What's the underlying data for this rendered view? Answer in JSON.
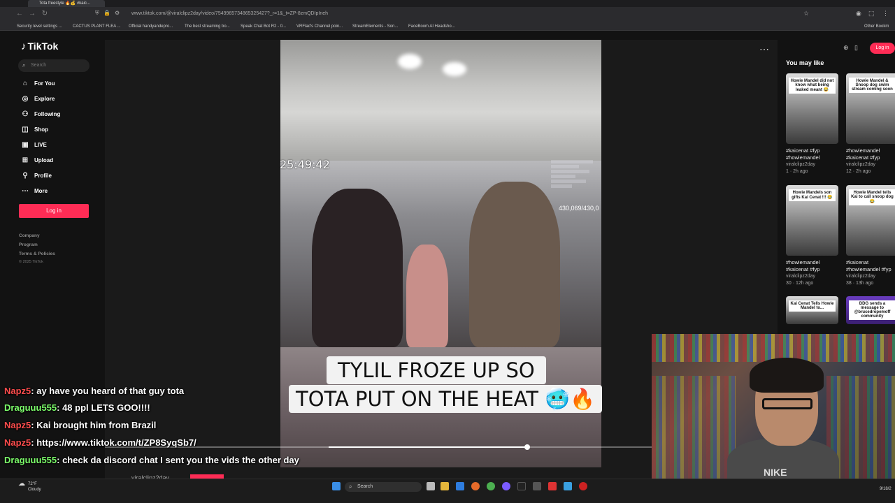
{
  "browser": {
    "tab_title": "Tota freestyle 🔥💰 #kaic...",
    "url": "www.tiktok.com/@viralclipz2day/video/7549965734865325427?_r=1&_t=ZP-8zmQDIpIneh",
    "bookmarks": [
      "Security level settings ...",
      "CACTUS PLANT FLEA ...",
      "Official handyandepro...",
      "The best streaming bo...",
      "Speak Chat Bot R2 - 0...",
      "VRFlad's Channel poin...",
      "StreamElements - Son...",
      "FaceBoom AI Headsho..."
    ],
    "other_bookmarks": "Other Bookm"
  },
  "tiktok": {
    "logo": "TikTok",
    "search_placeholder": "Search",
    "nav": [
      {
        "label": "For You",
        "icon": "home-icon"
      },
      {
        "label": "Explore",
        "icon": "compass-icon"
      },
      {
        "label": "Following",
        "icon": "person-plus-icon"
      },
      {
        "label": "Shop",
        "icon": "shopping-bag-icon"
      },
      {
        "label": "LIVE",
        "icon": "live-icon"
      },
      {
        "label": "Upload",
        "icon": "plus-square-icon"
      },
      {
        "label": "Profile",
        "icon": "user-icon"
      },
      {
        "label": "More",
        "icon": "more-dots-icon"
      }
    ],
    "login_label": "Log in",
    "footer_links": [
      "Company",
      "Program",
      "Terms & Policies"
    ],
    "copyright": "© 2025 TikTok",
    "top_login": "Log in",
    "you_may_like": "You may like",
    "recommendations": [
      {
        "overlay": "Howie Mandel did not know what being leaked meant 😂",
        "tags": "#kaicenat #fyp #howiemandel",
        "author": "viralclipz2day",
        "meta": "1 · 2h ago"
      },
      {
        "overlay": "Howie Mandel & Snoop dog swim stream coming soon",
        "tags": "#howiemandel #kaicenat #fyp",
        "author": "viralclipz2day",
        "meta": "12 · 2h ago"
      },
      {
        "overlay": "Howie Mandels son gifts Kai Cenat !!! 😂",
        "tags": "#howiemandel #kaicenat #fyp",
        "author": "viralclipz2day",
        "meta": "30 · 12h ago"
      },
      {
        "overlay": "Howie Mandel tells Kai to call snoop dog 😂",
        "tags": "#kaicenat #howiemandel #fyp",
        "author": "viralclipz2day",
        "meta": "38 · 13h ago"
      },
      {
        "overlay": "Kai Cenat Tells Howie Mandel to...",
        "tags": "",
        "author": "",
        "meta": ""
      },
      {
        "overlay": "DDG sends a message to @brucedropemoff community",
        "tags": "",
        "author": "",
        "meta": ""
      }
    ],
    "video": {
      "timer": "25:49:42",
      "sub_counter": "430,069/430,0",
      "caption_line1": "TYLIL FROZE UP SO",
      "caption_line2": "TOTA PUT ON THE HEAT 🥶🔥",
      "progress": 0.71,
      "creator": "viralclipz2day"
    }
  },
  "stream_chat": [
    {
      "user": "Napz5",
      "message": ": ay have you heard of that guy tota",
      "color": "#ff4d4d"
    },
    {
      "user": "Draguuu555",
      "message": ": 48 ppl LETS GOO!!!!",
      "color": "#7dff6b"
    },
    {
      "user": "Napz5",
      "message": ": Kai brought him from Brazil",
      "color": "#ff4d4d"
    },
    {
      "user": "Napz5",
      "message": ": https://www.tiktok.com/t/ZP8SyqSb7/",
      "color": "#ff4d4d"
    },
    {
      "user": "Draguuu555",
      "message": ": check da discord chat I sent you the vids the other day",
      "color": "#7dff6b"
    }
  ],
  "taskbar": {
    "weather_temp": "72°F",
    "weather_desc": "Cloudy",
    "search_label": "Search",
    "date": "9/18/2"
  },
  "colors": {
    "accent": "#fe2c55",
    "background": "#121212"
  }
}
